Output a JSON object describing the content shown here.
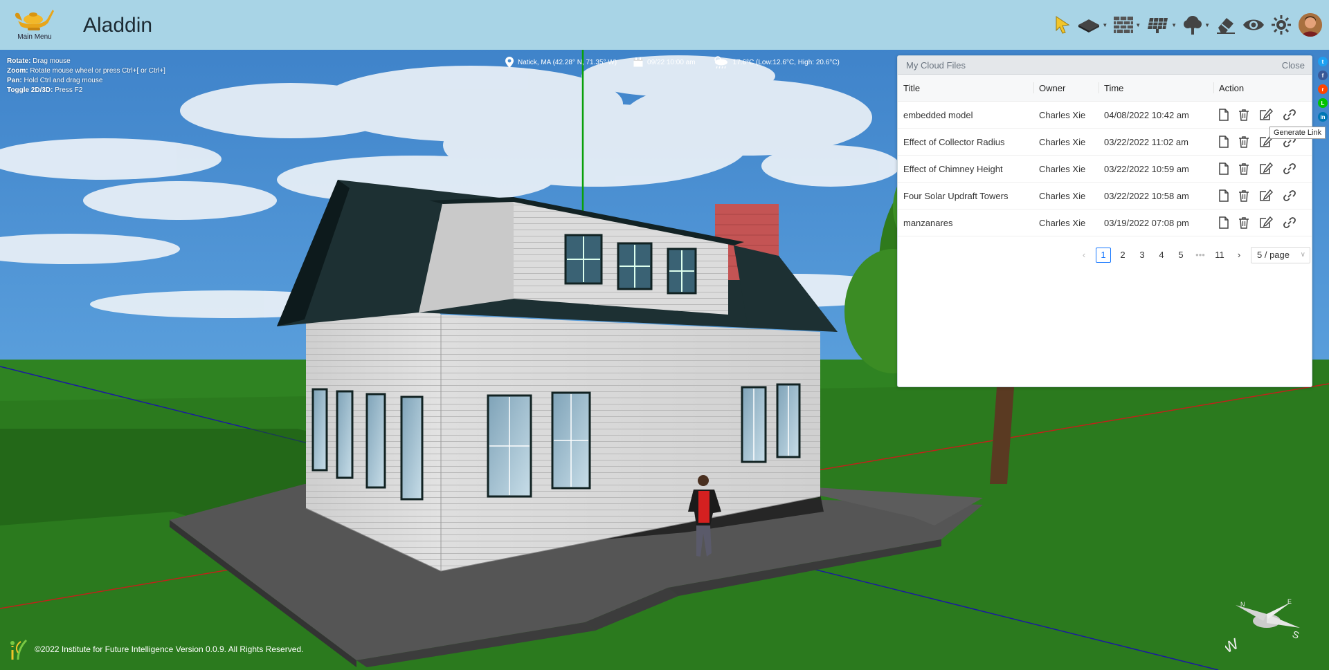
{
  "app": {
    "title": "Aladdin",
    "main_menu_label": "Main Menu"
  },
  "toolbar": {
    "items": [
      {
        "name": "select-tool",
        "icon": "arrow-cursor-icon"
      },
      {
        "name": "foundation-tool",
        "icon": "foundation-icon"
      },
      {
        "name": "wall-tool",
        "icon": "brick-wall-icon"
      },
      {
        "name": "solar-panel-tool",
        "icon": "solar-panel-icon"
      },
      {
        "name": "tree-tool",
        "icon": "tree-icon"
      },
      {
        "name": "eraser-tool",
        "icon": "eraser-icon"
      },
      {
        "name": "visibility-tool",
        "icon": "eye-icon"
      },
      {
        "name": "settings-tool",
        "icon": "sun-gear-icon"
      }
    ]
  },
  "help": {
    "rotate_key": "Rotate:",
    "rotate_text": " Drag mouse",
    "zoom_key": "Zoom:",
    "zoom_text": " Rotate mouse wheel or press Ctrl+[ or Ctrl+]",
    "pan_key": "Pan:",
    "pan_text": " Hold Ctrl and drag mouse",
    "toggle_key": "Toggle 2D/3D:",
    "toggle_text": " Press F2"
  },
  "status": {
    "location": "Natick, MA (42.28° N, 71.35° W)",
    "datetime": "09/22 10:00 am",
    "weather": "17.6°C (Low:12.6°C, High: 20.6°C)"
  },
  "cloud_panel": {
    "title": "My Cloud Files",
    "close_label": "Close",
    "columns": [
      "Title",
      "Owner",
      "Time",
      "Action"
    ],
    "rows": [
      {
        "title": "embedded model",
        "owner": "Charles Xie",
        "time": "04/08/2022 10:42 am"
      },
      {
        "title": "Effect of Collector Radius",
        "owner": "Charles Xie",
        "time": "03/22/2022 11:02 am"
      },
      {
        "title": "Effect of Chimney Height",
        "owner": "Charles Xie",
        "time": "03/22/2022 10:59 am"
      },
      {
        "title": "Four Solar Updraft Towers",
        "owner": "Charles Xie",
        "time": "03/22/2022 10:58 am"
      },
      {
        "title": "manzanares",
        "owner": "Charles Xie",
        "time": "03/19/2022 07:08 pm"
      }
    ],
    "pagination": {
      "pages": [
        "1",
        "2",
        "3",
        "4",
        "5"
      ],
      "ellipsis": "•••",
      "last": "11",
      "current": "1",
      "page_size": "5 / page"
    }
  },
  "tooltip": {
    "text": "Generate Link"
  },
  "footer": {
    "copyright": "©2022 Institute for Future Intelligence Version 0.0.9. All Rights Reserved."
  },
  "colors": {
    "header_bg": "#a8d4e6",
    "accent": "#1677ff",
    "roof": "#1d3033",
    "grass": "#2b7a1e"
  }
}
